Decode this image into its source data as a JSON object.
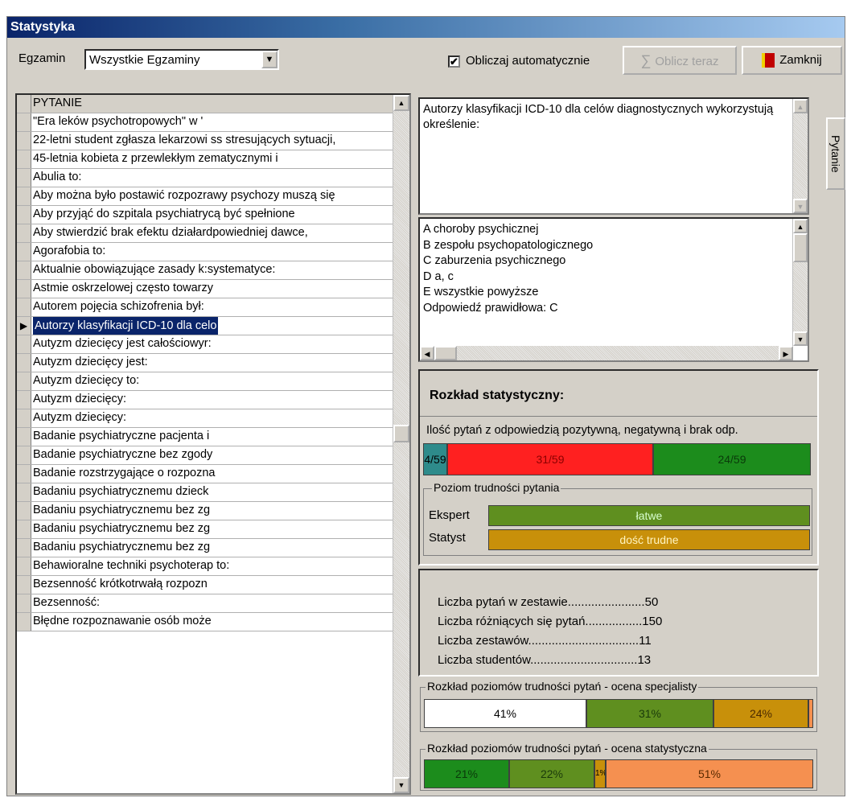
{
  "window": {
    "title": "Statystyka"
  },
  "toolbar": {
    "exam_label": "Egzamin",
    "exam_value": "Wszystkie Egzaminy",
    "auto_calc_label": "Obliczaj automatycznie",
    "auto_calc_checked": "✔",
    "calc_now_label": "Oblicz teraz",
    "close_label": "Zamknij"
  },
  "grid": {
    "header": "PYTANIE",
    "rows": [
      "\"Era leków psychotropowych\" w '",
      "22-letni student zgłasza lekarzowi ss stresujących sytuacji,",
      "45-letnia kobieta z przewlekłym zematycznymi i",
      "Abulia to:",
      "Aby można było postawić rozpozrawy psychozy muszą się",
      "Aby przyjąć do szpitala psychiatrycą być spełnione",
      "Aby stwierdzić brak efektu działardpowiedniej dawce,",
      "Agorafobia to:",
      "Aktualnie obowiązujące  zasady k:systematyce:",
      "Astmie oskrzelowej często towarzy",
      "Autorem pojęcia schizofrenia był:",
      "Autorzy klasyfikacji ICD-10 dla celo",
      "Autyzm dziecięcy jest całościowyr:",
      "Autyzm dziecięcy jest:",
      "Autyzm dziecięcy to:",
      "Autyzm dziecięcy:",
      "Autyzm dziecięcy:",
      "Badanie psychiatryczne pacjenta i",
      "Badanie psychiatryczne bez zgody",
      "Badanie rozstrzygające o rozpozna",
      "Badaniu psychiatrycznemu dzieck",
      "Badaniu psychiatrycznemu bez zg",
      "Badaniu psychiatrycznemu bez zg",
      "Badaniu psychiatrycznemu bez zg",
      "Behawioralne techniki psychoterap to:",
      "Bezsenność krótkotrwałą rozpozn",
      "Bezsenność:",
      "Błędne rozpoznawanie osób może"
    ]
  },
  "question": {
    "text": "Autorzy klasyfikacji ICD-10 dla celów diagnostycznych wykorzystują określenie:",
    "answers": "A choroby psychicznej\nB zespołu psychopatologicznego\nC zaburzenia psychicznego\nD a, c\nE wszystkie powyższe\nOdpowiedź prawidłowa: C"
  },
  "tab_label": "Pytanie",
  "stats": {
    "title": "Rozkład statystyczny:",
    "answers_header": "Ilość pytań z odpowiedzią pozytywną, negatywną i brak odp.",
    "bar_none": "4/59",
    "bar_negative": "31/59",
    "bar_positive": "24/59",
    "difficulty_title": "Poziom trudności pytania",
    "expert_label": "Ekspert",
    "expert_value": "łatwe",
    "statyst_label": "Statyst",
    "statyst_value": "dość trudne"
  },
  "counts": {
    "q_in_set": "Liczba pytań w zestawie.......................50",
    "q_distinct": "Liczba różniących się pytań.................150",
    "sets": "Liczba zestawów.................................11",
    "students": "Liczba studentów................................13"
  },
  "expert_dist": {
    "title": "Rozkład poziomów trudności pytań - ocena specjalisty",
    "v1": "41%",
    "v2": "31%",
    "v3": "24%",
    "v4": ""
  },
  "stat_dist": {
    "title": "Rozkład poziomów trudności pytań - ocena statystyczna",
    "v1": "21%",
    "v2": "22%",
    "v3": "1%",
    "v4": "51%"
  },
  "colors": {
    "teal": "#2e8b8b",
    "red": "#ff2020",
    "green": "#1c8c1c",
    "olive": "#5f8f1f",
    "gold": "#c8900a",
    "orange": "#f59050"
  }
}
